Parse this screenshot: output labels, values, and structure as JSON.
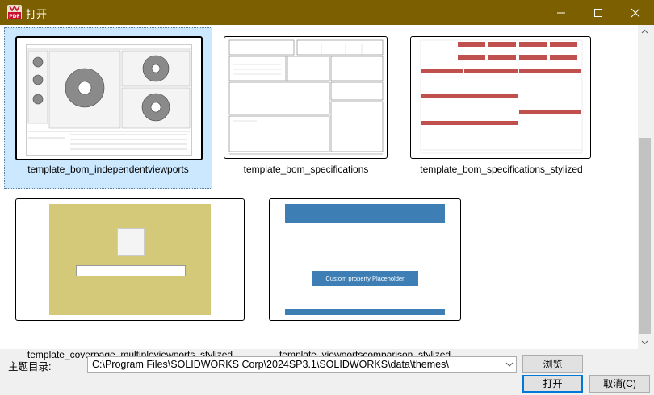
{
  "window": {
    "title": "打开",
    "app_icon_text": "PDF"
  },
  "thumbnails": [
    {
      "label": "template_bom_independentviewports",
      "selected": true
    },
    {
      "label": "template_bom_specifications",
      "selected": false
    },
    {
      "label": "template_bom_specifications_stylized",
      "selected": false
    },
    {
      "label": "template_coverpage_multipleviewports_stylized",
      "selected": false
    },
    {
      "label": "template_viewportscomparison_stylized",
      "selected": false
    }
  ],
  "previews": {
    "placeholder": "Custom property Placeholder"
  },
  "footer": {
    "theme_dir_label": "主题目录:",
    "theme_dir_value": "C:\\Program Files\\SOLIDWORKS Corp\\2024SP3.1\\SOLIDWORKS\\data\\themes\\",
    "browse_label": "浏览",
    "open_label": "打开",
    "cancel_label": "取消(C)"
  },
  "colors": {
    "titlebar": "#7b5f00",
    "selection": "#cce8ff",
    "stylized_red": "#c0504d",
    "blue": "#3d7fb5",
    "olive": "#d3c979"
  }
}
